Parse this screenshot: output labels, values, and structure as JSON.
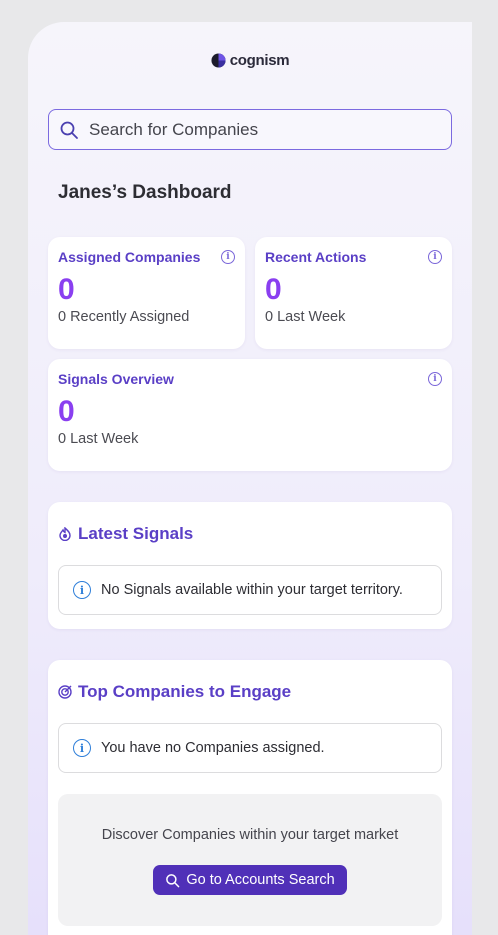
{
  "brand": {
    "name": "cognism",
    "logo_icon": "cognism-logo-icon"
  },
  "search": {
    "placeholder": "Search for Companies",
    "icon": "search-icon"
  },
  "dashboard": {
    "title": "Janes’s Dashboard"
  },
  "stats": {
    "assigned": {
      "label": "Assigned Companies",
      "value": "0",
      "sub_value": "0",
      "sub_label": "Recently Assigned"
    },
    "recent": {
      "label": "Recent Actions",
      "value": "0",
      "sub_value": "0",
      "sub_label": "Last Week"
    },
    "signals": {
      "label": "Signals Overview",
      "value": "0",
      "sub_value": "0",
      "sub_label": "Last Week"
    }
  },
  "latest_signals": {
    "title": "Latest Signals",
    "icon": "signals-icon",
    "notice": "No Signals available within your target territory."
  },
  "top_companies": {
    "title": "Top Companies to Engage",
    "icon": "target-icon",
    "notice": "You have no Companies assigned.",
    "discover_text": "Discover Companies within your target market",
    "button_label": "Go to Accounts Search"
  },
  "colors": {
    "accent": "#5a3fc6",
    "value": "#8a3ff0",
    "button": "#5030b8",
    "info": "#2f7fd9"
  }
}
